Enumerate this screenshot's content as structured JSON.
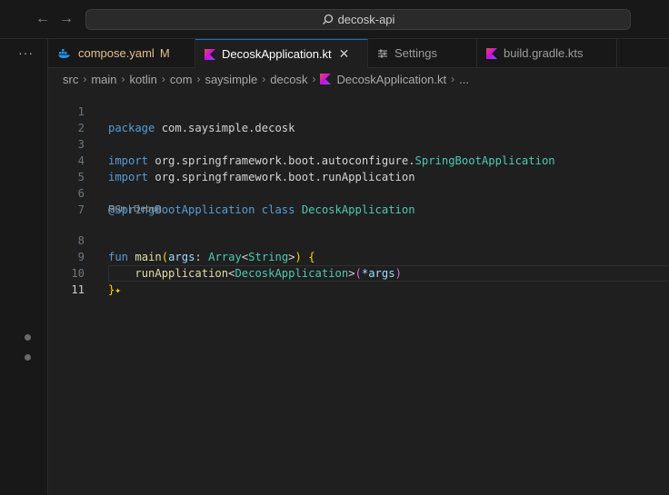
{
  "search": {
    "text": "decosk-api"
  },
  "tabs": [
    {
      "label": "compose.yaml",
      "modified": "M"
    },
    {
      "label": "DecoskApplication.kt",
      "close": "✕"
    },
    {
      "label": "Settings"
    },
    {
      "label": "build.gradle.kts"
    }
  ],
  "breadcrumb": [
    "src",
    "main",
    "kotlin",
    "com",
    "saysimple",
    "decosk",
    "DecoskApplication.kt",
    "..."
  ],
  "editor": {
    "line_numbers": [
      "1",
      "2",
      "3",
      "4",
      "5",
      "6",
      "7",
      "8",
      "9",
      "10",
      "11"
    ],
    "codelens": "Run | Debug",
    "lines": {
      "l1": {
        "kw": "package",
        "rest": " com.saysimple.decosk"
      },
      "l3": {
        "kw": "import",
        "rest": " org.springframework.boot.autoconfigure.",
        "ty": "SpringBootApplication"
      },
      "l4": {
        "kw": "import",
        "rest": " org.springframework.boot.runApplication"
      },
      "l6": {
        "ann": "@SpringBootApplication",
        "kw": "class",
        "ty": "DecoskApplication"
      },
      "l8": {
        "kw": "fun",
        "fn": "main",
        "p1": "(",
        "pa": "args",
        "colon": ": ",
        "ty1": "Array",
        "lt": "<",
        "ty2": "String",
        "gt": ">",
        "p2": ")",
        "brace": "{"
      },
      "l9": {
        "fn": "runApplication",
        "lt": "<",
        "ty": "DecoskApplication",
        "gt": ">",
        "p1": "(",
        "pa": "*args",
        "p2": ")"
      },
      "l10": {
        "brace": "}",
        "sparkle": "✦"
      }
    }
  },
  "colors": {
    "accent": "#0078d4",
    "keyword": "#569cd6",
    "type": "#4ec9b0",
    "function": "#dcdcaa",
    "modified": "#e2c08d"
  }
}
